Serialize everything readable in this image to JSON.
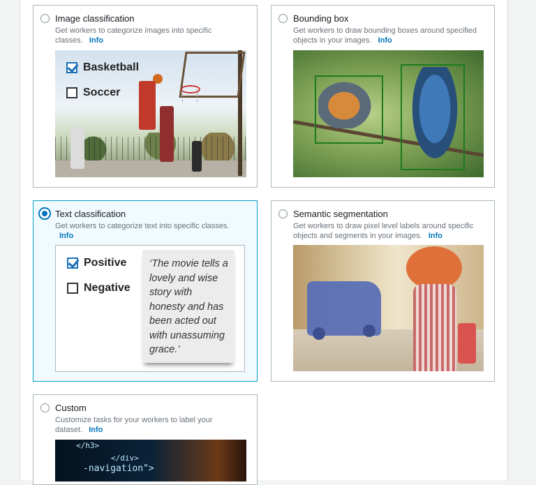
{
  "cards": {
    "image_classification": {
      "title": "Image classification",
      "description": "Get workers to categorize images into specific classes.",
      "info": "Info",
      "labels": [
        "Basketball",
        "Soccer"
      ]
    },
    "bounding_box": {
      "title": "Bounding box",
      "description": "Get workers to draw bounding boxes around specified objects in your images.",
      "info": "Info"
    },
    "text_classification": {
      "title": "Text classification",
      "description": "Get workers to categorize text into specific classes.",
      "info": "Info",
      "labels": [
        "Positive",
        "Negative"
      ],
      "quote": "‘The movie tells a lovely and wise story with honesty and has been acted out with unassuming grace.’",
      "selected": true
    },
    "semantic_segmentation": {
      "title": "Semantic segmentation",
      "description": "Get workers to draw pixel level labels around specific objects and segments in your images.",
      "info": "Info"
    },
    "custom": {
      "title": "Custom",
      "description": "Customize tasks for your workers to label your dataset.",
      "info": "Info",
      "code_lines": [
        "</h3>",
        "</div>",
        "-navigation\">"
      ]
    }
  },
  "colors": {
    "accent": "#0073bb",
    "selected_border": "#00a1c9",
    "selected_bg": "#f1faff"
  }
}
